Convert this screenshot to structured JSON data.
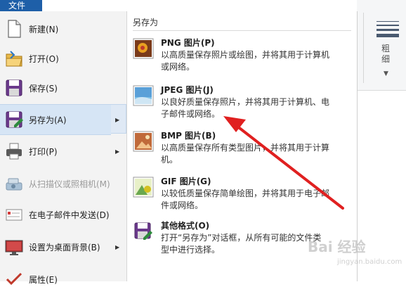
{
  "file_tab": "文件",
  "ribbon": {
    "thickness_label": "粗细"
  },
  "left_menu": {
    "items": [
      {
        "label": "新建(N)"
      },
      {
        "label": "打开(O)"
      },
      {
        "label": "保存(S)"
      },
      {
        "label": "另存为(A)"
      },
      {
        "label": "打印(P)"
      },
      {
        "label": "从扫描仪或照相机(M)"
      },
      {
        "label": "在电子邮件中发送(D)"
      },
      {
        "label": "设置为桌面背景(B)"
      },
      {
        "label": "属性(E)"
      }
    ]
  },
  "save_as": {
    "header": "另存为",
    "items": [
      {
        "title": "PNG 图片(P)",
        "desc": "以高质量保存照片或绘图，并将其用于计算机或网络。"
      },
      {
        "title": "JPEG 图片(J)",
        "desc": "以良好质量保存照片，并将其用于计算机、电子邮件或网络。"
      },
      {
        "title": "BMP 图片(B)",
        "desc": "以高质量保存所有类型图片，并将其用于计算机。"
      },
      {
        "title": "GIF 图片(G)",
        "desc": "以较低质量保存简单绘图，并将其用于电子邮件或网络。"
      },
      {
        "title": "其他格式(O)",
        "desc": "打开“另存为”对话框，从所有可能的文件类型中进行选择。"
      }
    ]
  },
  "watermark": {
    "text": "Bai 经验",
    "sub": "jingyan.baidu.com"
  },
  "colors": {
    "accent": "#1e5fa8",
    "arrow": "#e02020",
    "hover": "#d6e5f5"
  }
}
